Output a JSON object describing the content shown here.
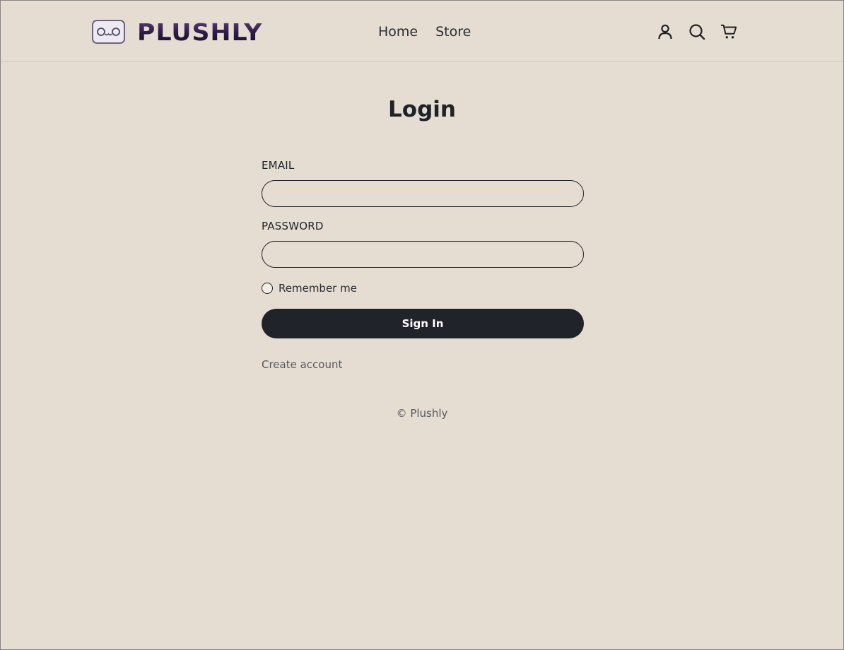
{
  "header": {
    "logo_text": "PLUSHLY",
    "nav": [
      {
        "label": "Home"
      },
      {
        "label": "Store"
      }
    ],
    "icons": [
      "account-icon",
      "search-icon",
      "cart-icon"
    ]
  },
  "main": {
    "title": "Login",
    "email_label": "EMAIL",
    "email_value": "",
    "password_label": "PASSWORD",
    "password_value": "",
    "remember_label": "Remember me",
    "remember_checked": false,
    "signin_label": "Sign In",
    "create_account_label": "Create account"
  },
  "footer": {
    "copyright": "© Plushly"
  },
  "colors": {
    "background": "#e5ddd2",
    "button": "#202329",
    "text": "#1f2227",
    "logo": "#3b2350"
  }
}
